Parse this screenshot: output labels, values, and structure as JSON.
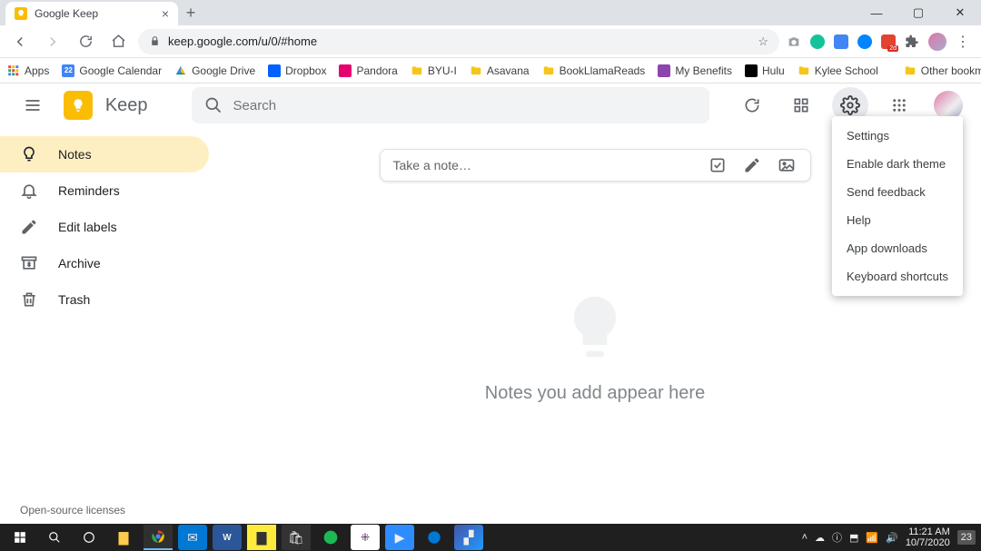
{
  "browser": {
    "tab_title": "Google Keep",
    "url": "keep.google.com/u/0/#home",
    "window_buttons": {
      "min": "—",
      "max": "▢",
      "close": "✕"
    },
    "bookmarks": [
      {
        "label": "Apps",
        "color": "#ea4335",
        "type": "grid"
      },
      {
        "label": "Google Calendar",
        "color": "#4285f4",
        "type": "square",
        "badge": "22"
      },
      {
        "label": "Google Drive",
        "color": "#0f9d58",
        "type": "triangle"
      },
      {
        "label": "Dropbox",
        "color": "#0061ff",
        "type": "square"
      },
      {
        "label": "Pandora",
        "color": "#e6006f",
        "type": "square"
      },
      {
        "label": "BYU-I",
        "color": "#f5c518",
        "type": "folder"
      },
      {
        "label": "Asavana",
        "color": "#f5c518",
        "type": "folder"
      },
      {
        "label": "BookLlamaReads",
        "color": "#f5c518",
        "type": "folder"
      },
      {
        "label": "My Benefits",
        "color": "#8e44ad",
        "type": "square"
      },
      {
        "label": "Hulu",
        "color": "#1ce783",
        "type": "square",
        "bg": "#000"
      },
      {
        "label": "Kylee School",
        "color": "#f5c518",
        "type": "folder"
      }
    ],
    "other_bookmarks": "Other bookmarks",
    "extensions": [
      {
        "name": "camera",
        "color": "#9aa0a6"
      },
      {
        "name": "grammarly",
        "color": "#15c39a",
        "shape": "circle"
      },
      {
        "name": "ext-blue",
        "color": "#4285f4"
      },
      {
        "name": "messenger",
        "color": "#0084ff",
        "shape": "circle"
      },
      {
        "name": "todoist",
        "color": "#e44332",
        "badge": "2d"
      },
      {
        "name": "puzzle",
        "color": "#5f6368"
      }
    ]
  },
  "app": {
    "title": "Keep",
    "search_placeholder": "Search",
    "nav": [
      {
        "id": "notes",
        "label": "Notes",
        "icon": "bulb",
        "selected": true
      },
      {
        "id": "reminders",
        "label": "Reminders",
        "icon": "bell",
        "selected": false
      },
      {
        "id": "editlabels",
        "label": "Edit labels",
        "icon": "pencil",
        "selected": false
      },
      {
        "id": "archive",
        "label": "Archive",
        "icon": "archive",
        "selected": false
      },
      {
        "id": "trash",
        "label": "Trash",
        "icon": "trash",
        "selected": false
      }
    ],
    "take_note": "Take a note…",
    "empty_message": "Notes you add appear here",
    "header_icons": [
      "refresh",
      "grid",
      "settings",
      "apps",
      "avatar"
    ],
    "settings_menu": [
      "Settings",
      "Enable dark theme",
      "Send feedback",
      "Help",
      "App downloads",
      "Keyboard shortcuts"
    ],
    "footer": "Open-source licenses"
  },
  "taskbar": {
    "time": "11:21 AM",
    "date": "10/7/2020",
    "notifications": "23"
  }
}
